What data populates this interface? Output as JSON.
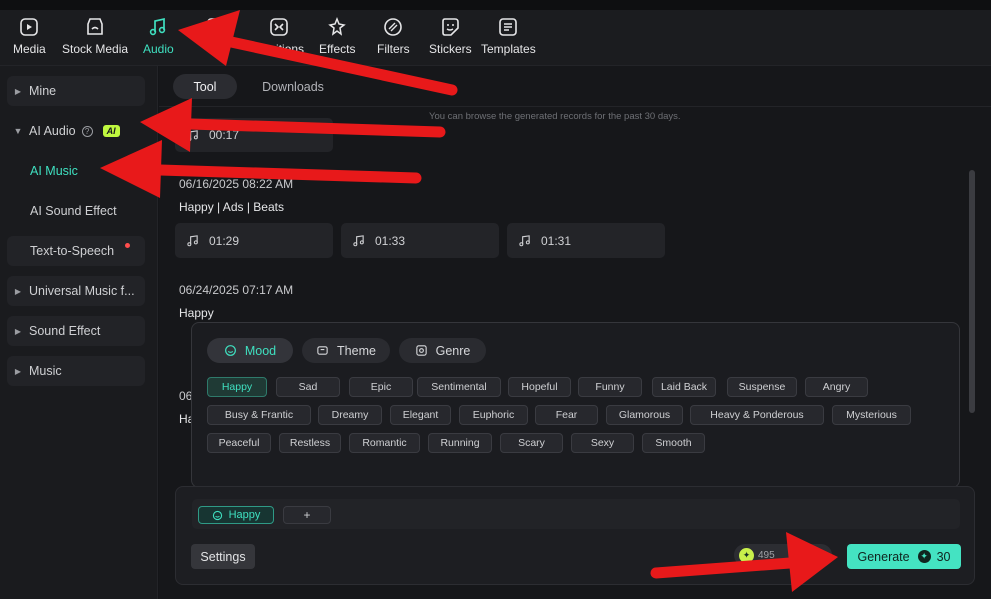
{
  "toolbar": {
    "items": [
      {
        "label": "Media",
        "icon": "media-icon"
      },
      {
        "label": "Stock Media",
        "icon": "stock-media-icon"
      },
      {
        "label": "Audio",
        "icon": "music-note-icon"
      },
      {
        "label": "Titles",
        "icon": "titles-icon"
      },
      {
        "label": "Transitions",
        "icon": "transitions-icon"
      },
      {
        "label": "Effects",
        "icon": "effects-icon"
      },
      {
        "label": "Filters",
        "icon": "filters-icon"
      },
      {
        "label": "Stickers",
        "icon": "stickers-icon"
      },
      {
        "label": "Templates",
        "icon": "templates-icon"
      }
    ],
    "active": "Audio",
    "active_color": "#3fe0c0",
    "transitions_visible_label": "sitions"
  },
  "sidebar": {
    "items": [
      {
        "label": "Mine"
      },
      {
        "label": "AI Audio",
        "badge": "AI"
      },
      {
        "label": "AI Music"
      },
      {
        "label": "AI Sound Effect"
      },
      {
        "label": "Text-to-Speech"
      },
      {
        "label": "Universal Music f..."
      },
      {
        "label": "Sound Effect"
      },
      {
        "label": "Music"
      }
    ]
  },
  "main": {
    "tabs": [
      {
        "label": "Tool"
      },
      {
        "label": "Downloads"
      }
    ],
    "hint": "You can browse the generated records for the past 30 days.",
    "records": [
      {
        "clips": [
          "00:17"
        ]
      },
      {
        "date": "06/16/2025 08:22 AM",
        "tags": "Happy | Ads | Beats",
        "clips": [
          "01:29",
          "01:33",
          "01:31"
        ]
      },
      {
        "date": "06/24/2025 07:17 AM",
        "tags": "Happy"
      },
      {
        "date_partial": "06",
        "tags_partial": "Ha"
      }
    ]
  },
  "popup": {
    "categories": [
      {
        "label": "Mood"
      },
      {
        "label": "Theme"
      },
      {
        "label": "Genre"
      }
    ],
    "moods": [
      "Happy",
      "Sad",
      "Epic",
      "Sentimental",
      "Hopeful",
      "Funny",
      "Laid Back",
      "Suspense",
      "Angry",
      "Busy & Frantic",
      "Dreamy",
      "Elegant",
      "Euphoric",
      "Fear",
      "Glamorous",
      "Heavy & Ponderous",
      "Mysterious",
      "Peaceful",
      "Restless",
      "Romantic",
      "Running",
      "Scary",
      "Sexy",
      "Smooth"
    ],
    "selected": "Happy"
  },
  "panel": {
    "selected_chip": "Happy",
    "add_label": "+",
    "settings_label": "Settings",
    "credits_partial": "495",
    "generate_label": "Generate",
    "generate_cost": "30"
  },
  "colors": {
    "accent": "#3fe0c0",
    "ai_badge": "#bff83f",
    "arrow": "#e8191a"
  }
}
